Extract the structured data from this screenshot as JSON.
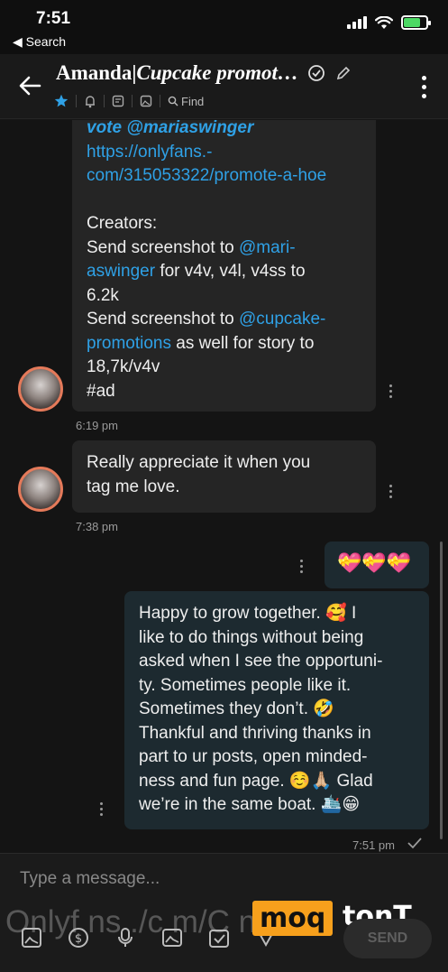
{
  "status": {
    "time": "7:51",
    "back_label": "◀ Search"
  },
  "header": {
    "title_name": "Amanda|",
    "title_handle": "Cupcake promot…",
    "find_label": "Find"
  },
  "messages": {
    "m1": {
      "line1": "vote @mariaswinger",
      "link1a": "https://onlyfans.-",
      "link1b": "com/315053322/promote-a-hoe",
      "creators": "Creators:",
      "l1a": "Send screenshot to ",
      "l1b": "@mari-",
      "l2a": "aswinger",
      "l2b": " for v4v, v4l, v4ss to",
      "l3": "6.2k",
      "l4a": "Send screenshot to ",
      "l4b": "@cupcake-",
      "l5a": "promotions",
      "l5b": " as well for story to",
      "l6": "18,7k/v4v",
      "l7": "#ad",
      "time": "6:19 pm"
    },
    "m2": {
      "l1": "Really appreciate it when you",
      "l2": "tag me love.",
      "time": "7:38 pm"
    },
    "m3": {
      "text": "💝💝💝"
    },
    "m4": {
      "l1": "Happy to grow together. 🥰 I",
      "l2": "like to do things without being",
      "l3": "asked when I see the opportuni-",
      "l4": "ty. Sometimes people like it.",
      "l5": "Sometimes they don’t. 🤣",
      "l6": "Thankful and thriving thanks in",
      "l7": "part to ur posts, open minded-",
      "l8": "ness and fun page. ☺️🙏🏼 Glad",
      "l9": "we’re in the same boat. 🛳️😁",
      "time": "7:51 pm"
    }
  },
  "composer": {
    "placeholder": "Type a message...",
    "send_label": "SEND",
    "watermark": "Onlyf ns ./c m/C                    n7",
    "logo_badge": "moq",
    "logo_text": "tonT"
  },
  "colors": {
    "link": "#2fa1e6",
    "accent": "#f7a01c",
    "avatar_ring": "#e57a5a"
  }
}
